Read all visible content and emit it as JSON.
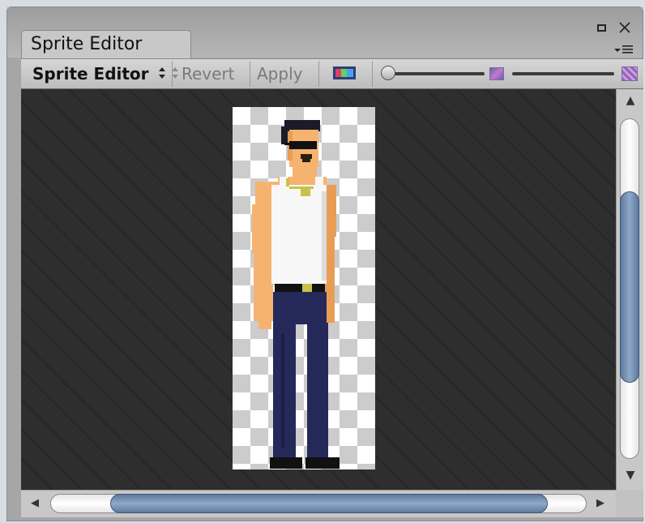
{
  "window": {
    "tab_title": "Sprite Editor",
    "maximize_glyph": "▪",
    "close_glyph": "✕",
    "menu_glyph": "▾≡"
  },
  "toolbar": {
    "mode_dropdown_label": "Sprite Editor",
    "mode_dropdown_arrows": "⬍",
    "revert_label": "Revert",
    "apply_label": "Apply",
    "zoom_slider_value": 0.0,
    "mip_slider_value": 1.0
  },
  "scrollbars": {
    "up_arrow": "▲",
    "down_arrow": "▼",
    "left_arrow": "◀",
    "right_arrow": "▶"
  },
  "colors": {
    "skin": "#f6b36f",
    "skin_shadow": "#e89d55",
    "hair": "#1b1b2a",
    "shirt": "#f7f7f7",
    "jeans": "#25295a",
    "belt": "#111111",
    "buckle": "#c9c24a",
    "shoes": "#111111",
    "scroll_thumb": "#6b84a6"
  },
  "icons": {
    "color_channel": "rgb-channel-icon",
    "small_preview": "small-texture-icon",
    "large_preview": "large-texture-icon"
  }
}
